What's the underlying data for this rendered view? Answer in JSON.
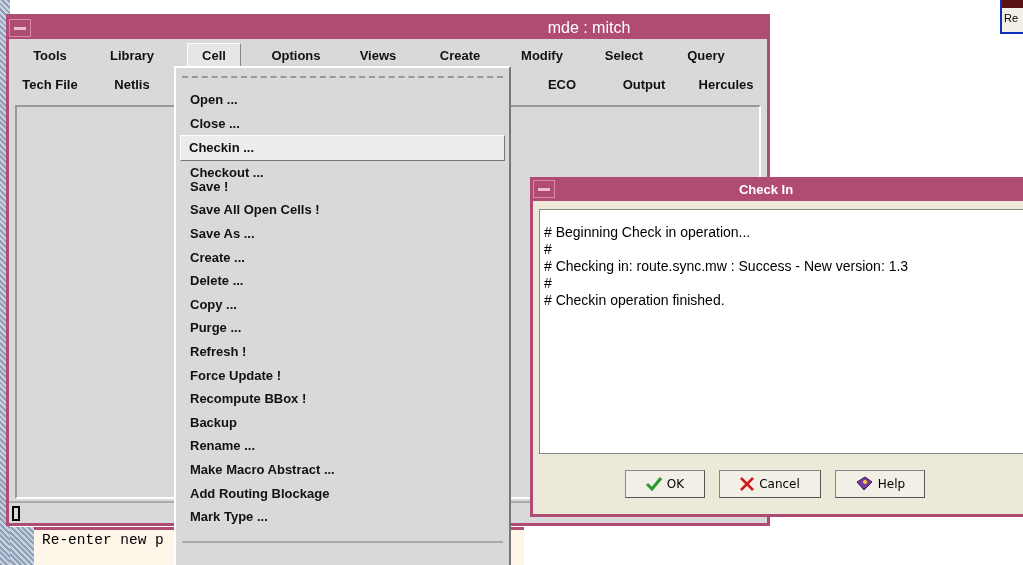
{
  "main_window": {
    "title": "mde : mitch",
    "menu_row_1": [
      {
        "label": "Tools",
        "selected": false
      },
      {
        "label": "Library",
        "selected": false
      },
      {
        "label": "Cell",
        "selected": true
      },
      {
        "label": "Options",
        "selected": false
      },
      {
        "label": "Views",
        "selected": false
      },
      {
        "label": "Create",
        "selected": false
      },
      {
        "label": "Modify",
        "selected": false
      },
      {
        "label": "Select",
        "selected": false
      },
      {
        "label": "Query",
        "selected": false
      }
    ],
    "menu_row_2_left": [
      "Tech File",
      "Netlis"
    ],
    "menu_row_2_right": [
      "ECO",
      "Output",
      "Hercules"
    ]
  },
  "cell_menu": {
    "items": [
      {
        "label": "Open ...",
        "selected": false
      },
      {
        "label": "Close ...",
        "selected": false
      },
      {
        "label": "Checkin ...",
        "selected": true
      },
      {
        "label": "Checkout ...",
        "selected": false
      },
      {
        "label": "Save !",
        "selected": false
      },
      {
        "label": "Save All Open Cells !",
        "selected": false
      },
      {
        "label": "Save As ...",
        "selected": false
      },
      {
        "label": "Create ...",
        "selected": false
      },
      {
        "label": "Delete ...",
        "selected": false
      },
      {
        "label": "Copy ...",
        "selected": false
      },
      {
        "label": "Purge ...",
        "selected": false
      },
      {
        "label": "Refresh !",
        "selected": false
      },
      {
        "label": "Force Update !",
        "selected": false
      },
      {
        "label": "Recompute BBox !",
        "selected": false
      },
      {
        "label": "Backup",
        "selected": false
      },
      {
        "label": "Rename ...",
        "selected": false
      },
      {
        "label": "Make Macro Abstract ...",
        "selected": false
      },
      {
        "label": "Add Routing Blockage",
        "selected": false
      },
      {
        "label": "Mark Type ...",
        "selected": false
      }
    ]
  },
  "check_in_dialog": {
    "title": "Check In",
    "log_lines": [
      "# Beginning Check in operation...",
      "#",
      "# Checking in: route.sync.mw : Success - New version: 1.3",
      "#",
      "# Checkin operation finished."
    ],
    "buttons": [
      {
        "kind": "ok",
        "label": "OK"
      },
      {
        "kind": "cancel",
        "label": "Cancel"
      },
      {
        "kind": "help",
        "label": "Help"
      }
    ]
  },
  "terminal": {
    "text": "Re-enter new p"
  },
  "corner_window": {
    "text": "Re"
  }
}
